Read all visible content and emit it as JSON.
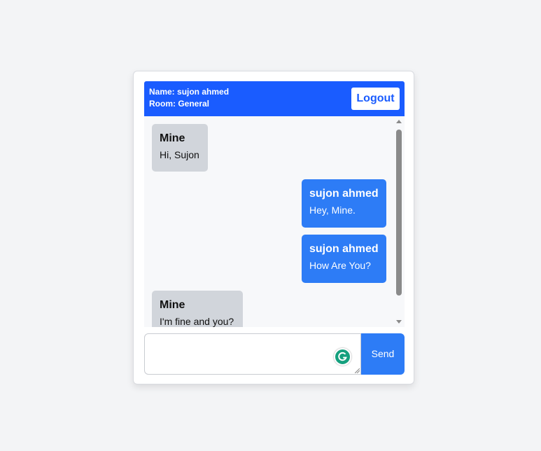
{
  "header": {
    "name_line": "Name: sujon ahmed",
    "room_line": "Room: General",
    "logout_label": "Logout"
  },
  "messages": [
    {
      "sender": "Mine",
      "text": "Hi, Sujon",
      "side": "other"
    },
    {
      "sender": "sujon ahmed",
      "text": "Hey, Mine.",
      "side": "self"
    },
    {
      "sender": "sujon ahmed",
      "text": "How Are You?",
      "side": "self"
    },
    {
      "sender": "Mine",
      "text": "I'm fine and you?",
      "side": "other"
    }
  ],
  "composer": {
    "value": "",
    "send_label": "Send"
  },
  "colors": {
    "header_bg": "#1a5cff",
    "self_bubble": "#2d7cf6",
    "other_bubble": "#d1d5db",
    "grammarly": "#15a07e"
  },
  "icons": {
    "extension": "grammarly-icon",
    "scroll_up": "scroll-up-arrow-icon",
    "scroll_down": "scroll-down-arrow-icon"
  }
}
